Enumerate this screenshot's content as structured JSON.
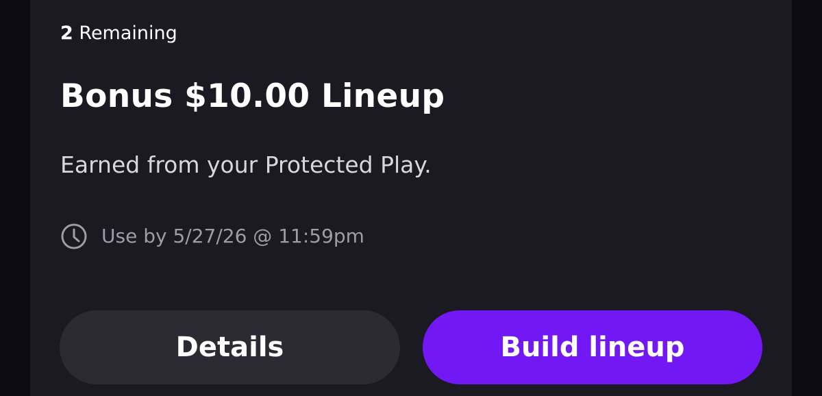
{
  "card": {
    "remaining_count": "2",
    "remaining_label": "Remaining",
    "title": "Bonus $10.00 Lineup",
    "description": "Earned from your Protected Play.",
    "expiry_icon": "clock-icon",
    "expiry_text": "Use by 5/27/26 @ 11:59pm"
  },
  "buttons": {
    "details_label": "Details",
    "build_label": "Build lineup"
  },
  "colors": {
    "background": "#0c0b12",
    "card": "#1b1a23",
    "secondary_button": "#2c2b34",
    "accent": "#7118f5",
    "muted_text": "#9e9da6"
  }
}
